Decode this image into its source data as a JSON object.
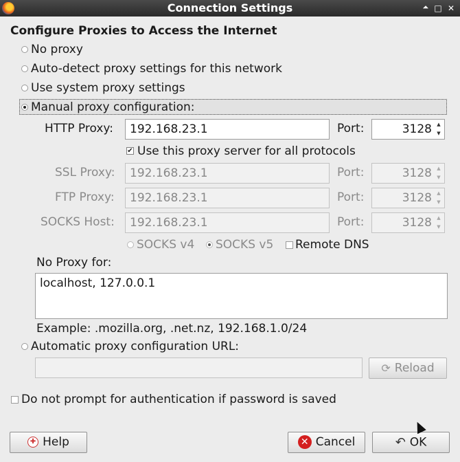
{
  "window": {
    "title": "Connection Settings",
    "minimize": "🞁",
    "maximize": "□",
    "close": "✕"
  },
  "heading": "Configure Proxies to Access the Internet",
  "options": {
    "no_proxy": "No proxy",
    "auto_detect": "Auto-detect proxy settings for this network",
    "system": "Use system proxy settings",
    "manual": "Manual proxy configuration:",
    "auto_url": "Automatic proxy configuration URL:"
  },
  "http": {
    "label": "HTTP Proxy:",
    "value": "192.168.23.1",
    "port_label": "Port:",
    "port": "3128"
  },
  "share": "Use this proxy server for all protocols",
  "ssl": {
    "label": "SSL Proxy:",
    "value": "192.168.23.1",
    "port_label": "Port:",
    "port": "3128"
  },
  "ftp": {
    "label": "FTP Proxy:",
    "value": "192.168.23.1",
    "port_label": "Port:",
    "port": "3128"
  },
  "socks": {
    "label": "SOCKS Host:",
    "value": "192.168.23.1",
    "port_label": "Port:",
    "port": "3128",
    "v4": "SOCKS v4",
    "v5": "SOCKS v5",
    "remote_dns": "Remote DNS"
  },
  "no_proxy_for": {
    "label": "No Proxy for:",
    "value": "localhost, 127.0.0.1",
    "example": "Example: .mozilla.org, .net.nz, 192.168.1.0/24"
  },
  "auto_url_value": "",
  "reload": "Reload",
  "no_prompt": "Do not prompt for authentication if password is saved",
  "buttons": {
    "help": "Help",
    "cancel": "Cancel",
    "ok": "OK"
  }
}
